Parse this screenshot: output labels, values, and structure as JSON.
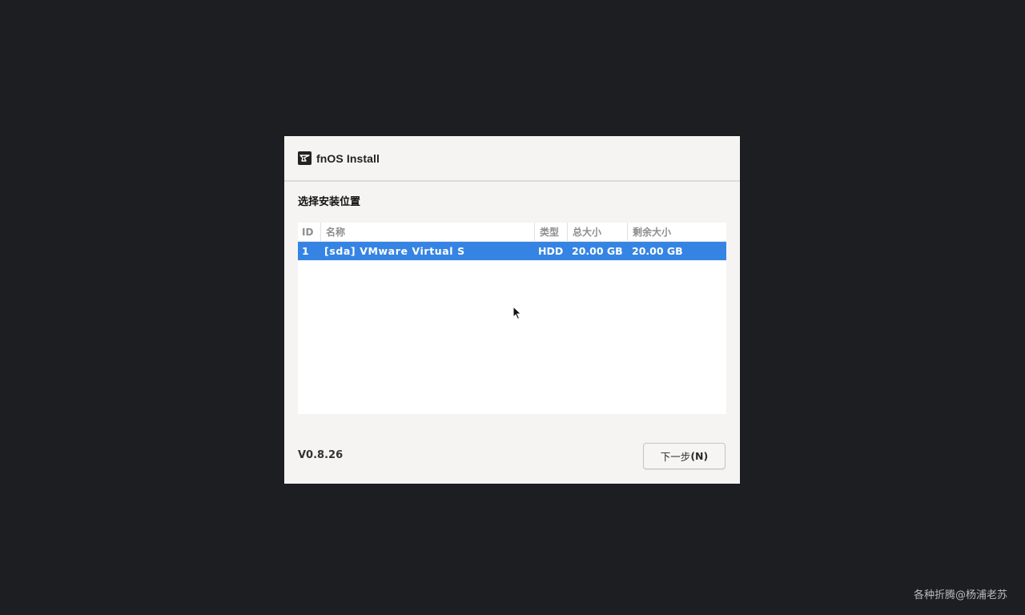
{
  "window": {
    "title": "fnOS Install",
    "logo_icon": "fnos-logo-icon"
  },
  "page": {
    "section_title": "选择安装位置",
    "version": "V0.8.26"
  },
  "disk_table": {
    "columns": [
      "ID",
      "名称",
      "类型",
      "总大小",
      "剩余大小"
    ],
    "rows": [
      {
        "id": "1",
        "name": "[sda] VMware Virtual S",
        "type": "HDD",
        "total": "20.00 GB",
        "free": "20.00 GB",
        "selected": true
      }
    ]
  },
  "buttons": {
    "next_label": "下一步",
    "next_mnemonic": "(N)"
  },
  "watermark": "各种折腾@杨浦老苏",
  "colors": {
    "background": "#1c1e22",
    "dialog": "#f5f4f2",
    "selection": "#3584e4"
  }
}
